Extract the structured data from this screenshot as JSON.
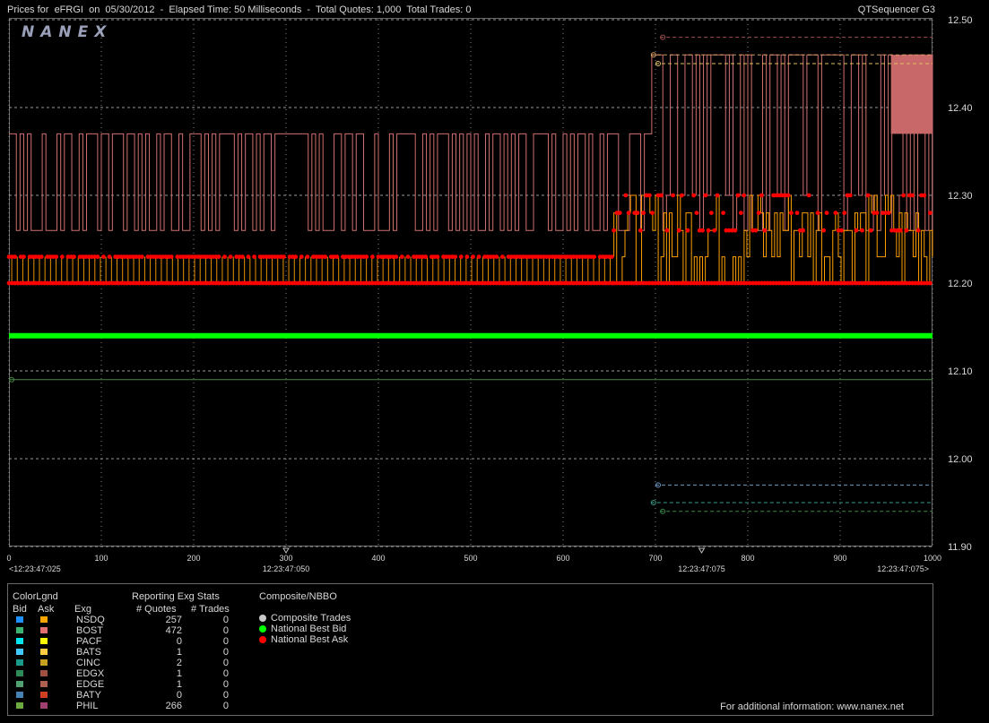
{
  "header": {
    "title": "Prices for  eFRGI  on  05/30/2012  -  Elapsed Time: 50 Milliseconds  -  Total Quotes: 1,000  Total Trades: 0",
    "app_name": "QTSequencer G3"
  },
  "logo": "NANEX",
  "colors": {
    "background": "#000000",
    "nbb": "#00ff00",
    "nbo": "#ff0000",
    "bost_ask": "#d07070",
    "nsdq_ask": "#ffa000",
    "grid": "#c8c8c8"
  },
  "chart_data": {
    "type": "line",
    "x_range": [
      0,
      1000
    ],
    "x_ticks": [
      0,
      100,
      200,
      300,
      400,
      500,
      600,
      700,
      800,
      900,
      1000
    ],
    "y_range": [
      11.9,
      12.5
    ],
    "y_ticks": [
      "12.50",
      "12.40",
      "12.30",
      "12.20",
      "12.10",
      "12.00",
      "11.90"
    ],
    "time_labels": [
      {
        "x": 0,
        "label": "<12:23:47:025"
      },
      {
        "x": 300,
        "label": "12:23:47:050"
      },
      {
        "x": 750,
        "label": "12:23:47:075"
      },
      {
        "x": 1000,
        "label": "12:23:47:075>"
      }
    ],
    "series": [
      {
        "name": "National Best Bid",
        "color": "#00ff00",
        "points": [
          [
            0,
            12.14
          ],
          [
            1000,
            12.14
          ]
        ]
      },
      {
        "name": "National Best Ask",
        "color": "#ff0000",
        "low": 12.2,
        "high": 12.23,
        "x_end": 655,
        "later_levels": [
          12.2,
          12.26,
          12.28,
          12.3
        ]
      },
      {
        "name": "BOST Ask",
        "color": "#d07070",
        "low": 12.26,
        "high": 12.37,
        "x_switch": 695,
        "later_high": 12.46
      }
    ],
    "reference_lines": [
      {
        "y": 12.48,
        "x_start": 705,
        "color": "#a05050",
        "dashed": true
      },
      {
        "y": 12.46,
        "x_start": 695,
        "color": "#d0a060",
        "dashed": true
      },
      {
        "y": 12.45,
        "x_start": 700,
        "color": "#e0c060",
        "dashed": true
      },
      {
        "y": 12.09,
        "x_start": 0,
        "color": "#4a8a4a",
        "dashed": false
      },
      {
        "y": 11.97,
        "x_start": 700,
        "color": "#6a9ac8",
        "dashed": true
      },
      {
        "y": 11.95,
        "x_start": 695,
        "color": "#3a9a8a",
        "dashed": true
      },
      {
        "y": 11.94,
        "x_start": 705,
        "color": "#3a8a4a",
        "dashed": true
      }
    ]
  },
  "legend": {
    "header_colorlgnd": "ColorLgnd",
    "header_bid": "Bid",
    "header_ask": "Ask",
    "header_exg": "Exg",
    "header_stats": "Reporting Exg Stats",
    "header_quotes": "# Quotes",
    "header_trades": "# Trades",
    "header_composite": "Composite/NBBO",
    "rows": [
      {
        "exg": "NSDQ",
        "quotes": "257",
        "trades": "0",
        "bid_color": "#1e90ff",
        "ask_color": "#ffa500"
      },
      {
        "exg": "BOST",
        "quotes": "472",
        "trades": "0",
        "bid_color": "#3cb371",
        "ask_color": "#e07070"
      },
      {
        "exg": "PACF",
        "quotes": "0",
        "trades": "0",
        "bid_color": "#00e5ee",
        "ask_color": "#ffff00"
      },
      {
        "exg": "BATS",
        "quotes": "1",
        "trades": "0",
        "bid_color": "#40c8ff",
        "ask_color": "#ffcc44"
      },
      {
        "exg": "CINC",
        "quotes": "2",
        "trades": "0",
        "bid_color": "#1a9a8a",
        "ask_color": "#c8a020"
      },
      {
        "exg": "EDGX",
        "quotes": "1",
        "trades": "0",
        "bid_color": "#2e8b57",
        "ask_color": "#a05040"
      },
      {
        "exg": "EDGE",
        "quotes": "1",
        "trades": "0",
        "bid_color": "#50a070",
        "ask_color": "#b06050"
      },
      {
        "exg": "BATY",
        "quotes": "0",
        "trades": "0",
        "bid_color": "#4682b4",
        "ask_color": "#d04020"
      },
      {
        "exg": "PHIL",
        "quotes": "266",
        "trades": "0",
        "bid_color": "#6aaa40",
        "ask_color": "#a04070"
      }
    ],
    "composite": [
      {
        "label": "Composite Trades",
        "color": "#c8c8c8"
      },
      {
        "label": "National Best Bid",
        "color": "#00ff00"
      },
      {
        "label": "National Best Ask",
        "color": "#ff0000"
      }
    ]
  },
  "footer": "For additional information: www.nanex.net"
}
